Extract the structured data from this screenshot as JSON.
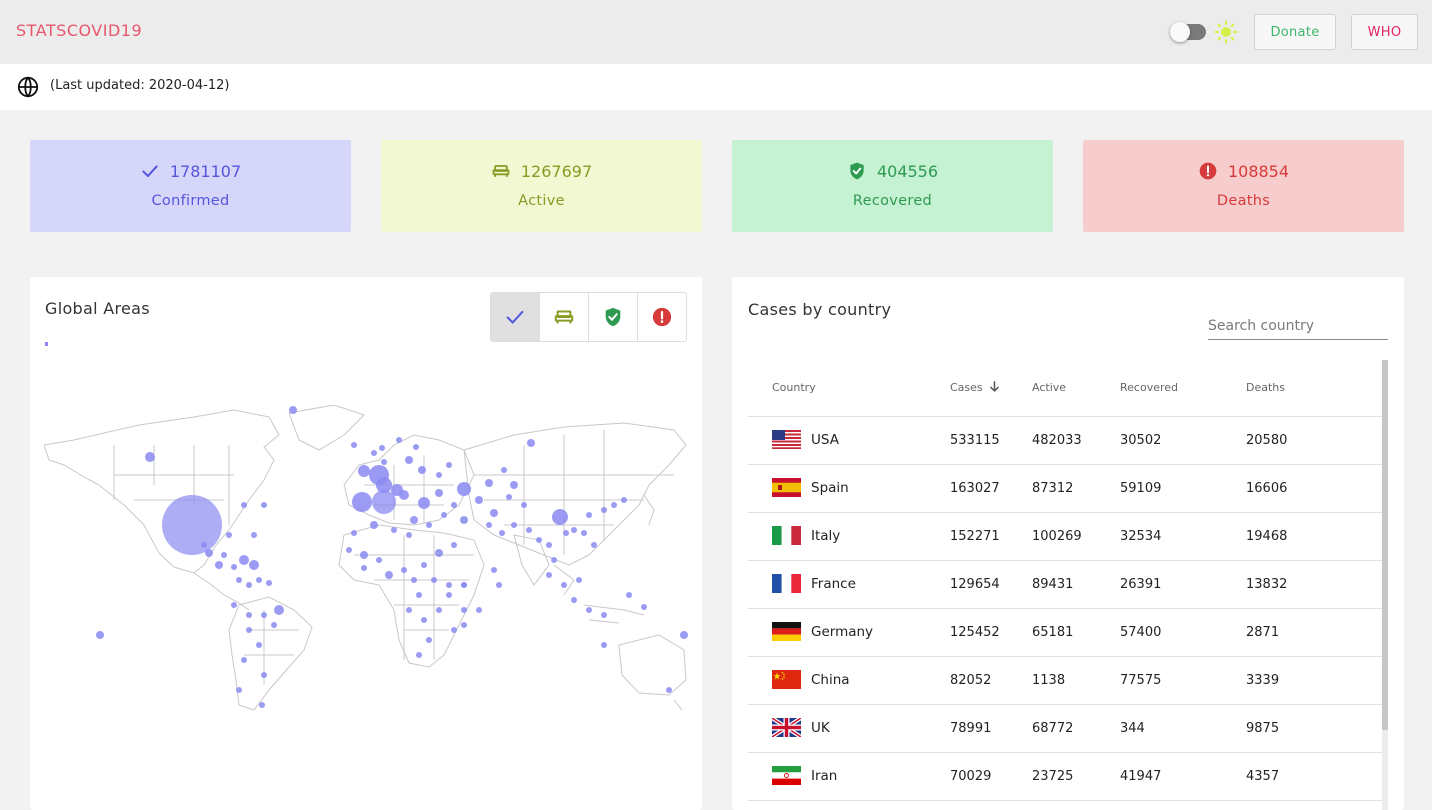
{
  "header": {
    "brand": "STATSCOVID19",
    "theme_toggle_on": false,
    "donate_label": "Donate",
    "who_label": "WHO",
    "colors": {
      "brand": "#e8566b",
      "donate": "#3bb86a",
      "who": "#e0245e",
      "sun": "#d6f04a"
    }
  },
  "subheader": {
    "last_updated": "(Last updated: 2020-04-12)"
  },
  "stats": [
    {
      "key": "confirmed",
      "value": "1781107",
      "label": "Confirmed",
      "icon": "check-icon",
      "color": "#5555dd",
      "bg": "#d6d6fa"
    },
    {
      "key": "active",
      "value": "1267697",
      "label": "Active",
      "icon": "bed-icon",
      "color": "#8a9a24",
      "bg": "#f1f8d2"
    },
    {
      "key": "recovered",
      "value": "404556",
      "label": "Recovered",
      "icon": "shield-check-icon",
      "color": "#2e9a52",
      "bg": "#c5f2d2"
    },
    {
      "key": "deaths",
      "value": "108854",
      "label": "Deaths",
      "icon": "alert-circle-icon",
      "color": "#d63a3a",
      "bg": "#f6cccc"
    }
  ],
  "map_panel": {
    "title": "Global Areas",
    "filters": [
      {
        "icon": "check-icon",
        "active": true
      },
      {
        "icon": "bed-icon",
        "active": false
      },
      {
        "icon": "shield-check-icon",
        "active": false
      },
      {
        "icon": "alert-circle-icon",
        "active": false
      }
    ],
    "bubble_color": "#8a8af2"
  },
  "table_panel": {
    "title": "Cases by country",
    "search_placeholder": "Search country",
    "columns": [
      "Country",
      "Cases",
      "Active",
      "Recovered",
      "Deaths"
    ],
    "sorted_by": "Cases",
    "rows": [
      {
        "country": "USA",
        "flag": "usa-flag-icon",
        "cases": "533115",
        "active": "482033",
        "recovered": "30502",
        "deaths": "20580"
      },
      {
        "country": "Spain",
        "flag": "spain-flag-icon",
        "cases": "163027",
        "active": "87312",
        "recovered": "59109",
        "deaths": "16606"
      },
      {
        "country": "Italy",
        "flag": "italy-flag-icon",
        "cases": "152271",
        "active": "100269",
        "recovered": "32534",
        "deaths": "19468"
      },
      {
        "country": "France",
        "flag": "france-flag-icon",
        "cases": "129654",
        "active": "89431",
        "recovered": "26391",
        "deaths": "13832"
      },
      {
        "country": "Germany",
        "flag": "germany-flag-icon",
        "cases": "125452",
        "active": "65181",
        "recovered": "57400",
        "deaths": "2871"
      },
      {
        "country": "China",
        "flag": "china-flag-icon",
        "cases": "82052",
        "active": "1138",
        "recovered": "77575",
        "deaths": "3339"
      },
      {
        "country": "UK",
        "flag": "uk-flag-icon",
        "cases": "78991",
        "active": "68772",
        "recovered": "344",
        "deaths": "9875"
      },
      {
        "country": "Iran",
        "flag": "iran-flag-icon",
        "cases": "70029",
        "active": "23725",
        "recovered": "41947",
        "deaths": "4357"
      }
    ]
  }
}
